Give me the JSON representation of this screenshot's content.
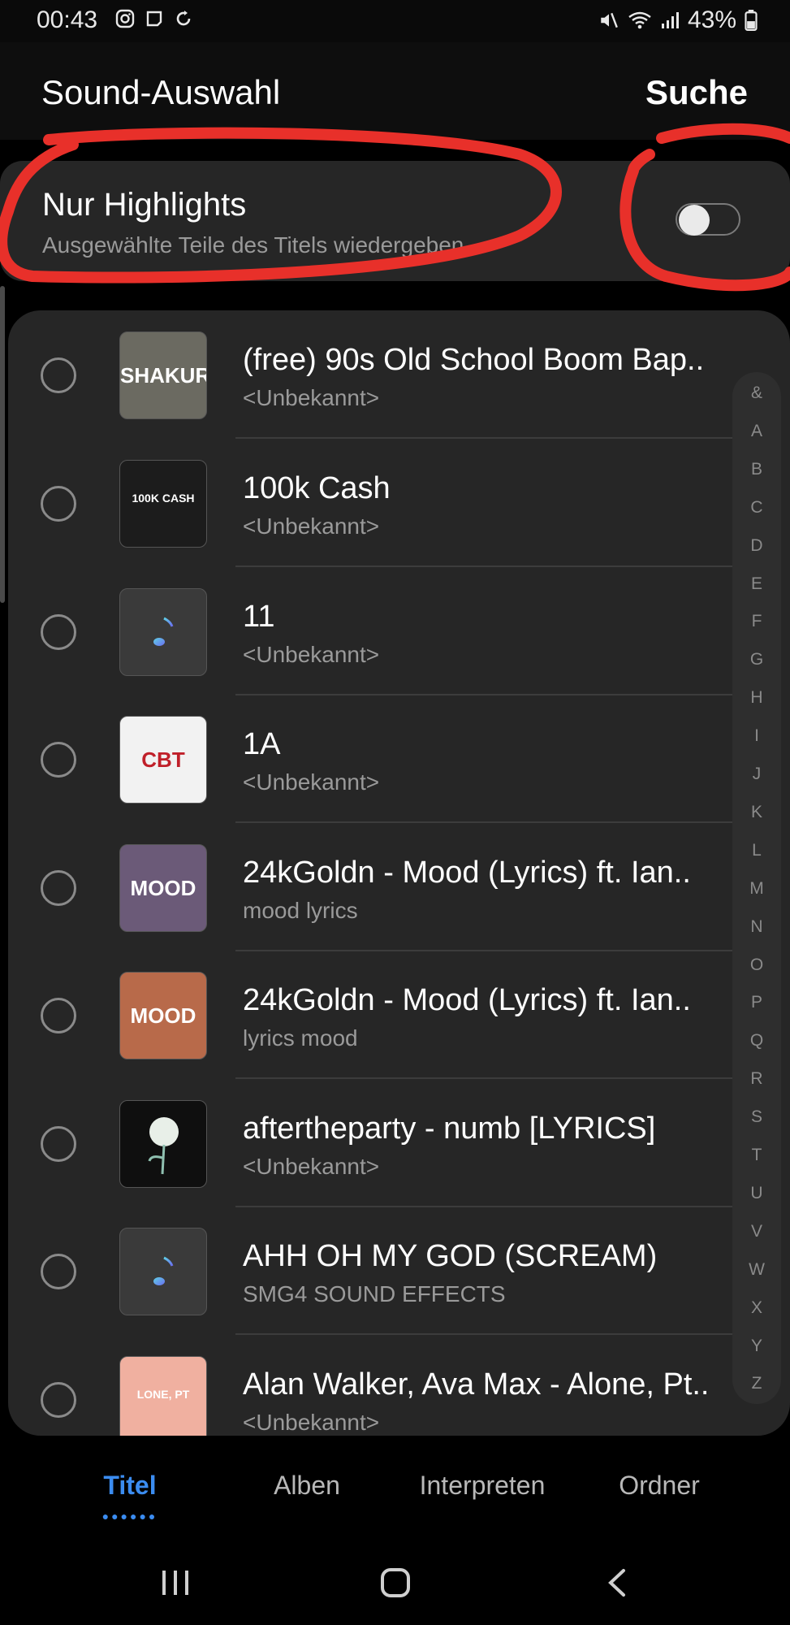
{
  "status_bar": {
    "time": "00:43",
    "battery": "43%"
  },
  "header": {
    "title": "Sound-Auswahl",
    "search_label": "Suche"
  },
  "highlights": {
    "title": "Nur Highlights",
    "subtitle": "Ausgewählte Teile des Titels wiedergeben.",
    "toggle_on": false
  },
  "songs": [
    {
      "title": "(free) 90s Old School Boom Bap..",
      "subtitle": "<Unbekannt>",
      "thumb_text": "SHAKUR",
      "thumb_bg": "#6b6a61"
    },
    {
      "title": "100k Cash",
      "subtitle": "<Unbekannt>",
      "thumb_text": "100K CASH",
      "thumb_bg": "#1c1c1c"
    },
    {
      "title": "11",
      "subtitle": "<Unbekannt>",
      "thumb_text": "",
      "thumb_bg": "#3a3a3a"
    },
    {
      "title": "1A",
      "subtitle": "<Unbekannt>",
      "thumb_text": "CBT",
      "thumb_bg": "#f2f2f2"
    },
    {
      "title": "24kGoldn - Mood (Lyrics) ft. Ian..",
      "subtitle": "mood lyrics",
      "thumb_text": "MOOD",
      "thumb_bg": "#6b5a78"
    },
    {
      "title": "24kGoldn - Mood (Lyrics) ft. Ian..",
      "subtitle": "lyrics mood",
      "thumb_text": "MOOD",
      "thumb_bg": "#b86a4a"
    },
    {
      "title": "aftertheparty - numb [LYRICS]",
      "subtitle": "<Unbekannt>",
      "thumb_text": "",
      "thumb_bg": "#0f0f0f"
    },
    {
      "title": "AHH OH MY GOD (SCREAM)",
      "subtitle": "SMG4 SOUND EFFECTS",
      "thumb_text": "",
      "thumb_bg": "#3a3a3a"
    },
    {
      "title": "Alan Walker, Ava Max - Alone, Pt..",
      "subtitle": "<Unbekannt>",
      "thumb_text": "LONE, PT",
      "thumb_bg": "#f0b0a0"
    }
  ],
  "index_letters": [
    "&",
    "A",
    "B",
    "C",
    "D",
    "E",
    "F",
    "G",
    "H",
    "I",
    "J",
    "K",
    "L",
    "M",
    "N",
    "O",
    "P",
    "Q",
    "R",
    "S",
    "T",
    "U",
    "V",
    "W",
    "X",
    "Y",
    "Z"
  ],
  "tabs": [
    {
      "label": "Titel",
      "active": true
    },
    {
      "label": "Alben",
      "active": false
    },
    {
      "label": "Interpreten",
      "active": false
    },
    {
      "label": "Ordner",
      "active": false
    }
  ],
  "colors": {
    "accent": "#3b8cf0",
    "annotation": "#e8302a",
    "panel": "#262626"
  }
}
